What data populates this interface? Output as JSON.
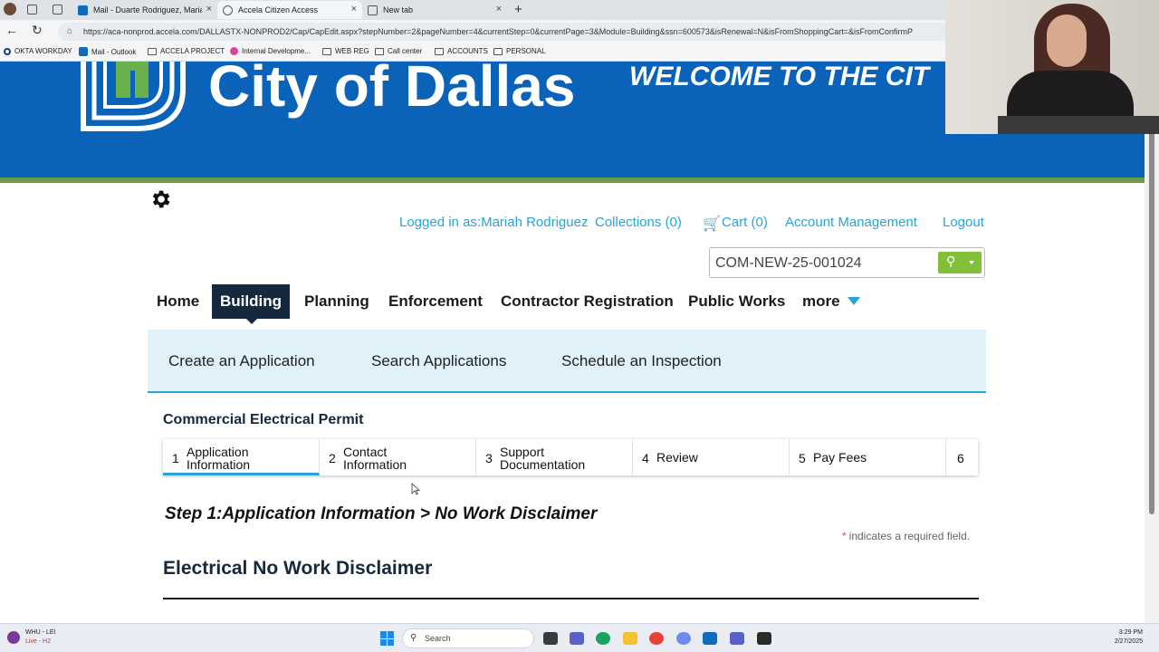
{
  "browser": {
    "tabs": [
      {
        "label": "Mail - Duarte Rodriguez, Mariah",
        "close": "×"
      },
      {
        "label": "Accela Citizen Access",
        "close": "×"
      },
      {
        "label": "New tab",
        "close": "×"
      }
    ],
    "new_tab": "+",
    "url": "https://aca-nonprod.accela.com/DALLASTX-NONPROD2/Cap/CapEdit.aspx?stepNumber=2&pageNumber=4&currentStep=0&currentPage=3&Module=Building&ssn=600573&isRenewal=N&isFromShoppingCart=&isFromConfirmP",
    "bookmarks": [
      "OKTA WORKDAY",
      "Mail - Outlook",
      "ACCELA PROJECT",
      "Internal Developme...",
      "WEB REG",
      "Call center",
      "ACCOUNTS",
      "PERSONAL"
    ]
  },
  "banner": {
    "title": "City of Dallas",
    "welcome": "WELCOME TO THE CIT"
  },
  "header": {
    "logged_in": "Logged in as:Mariah Rodriguez",
    "collections": "Collections (0)",
    "cart": "Cart (0)",
    "account": "Account Management",
    "logout": "Logout",
    "search_value": "COM-NEW-25-001024"
  },
  "nav": {
    "home": "Home",
    "building": "Building",
    "planning": "Planning",
    "enforcement": "Enforcement",
    "contractor": "Contractor Registration",
    "public_works": "Public Works",
    "more": "more"
  },
  "subnav": {
    "create": "Create an Application",
    "search": "Search Applications",
    "schedule": "Schedule an Inspection"
  },
  "permit": {
    "title": "Commercial Electrical Permit",
    "steps": [
      {
        "num": "1",
        "line1": "Application",
        "line2": "Information"
      },
      {
        "num": "2",
        "line1": "Contact",
        "line2": "Information"
      },
      {
        "num": "3",
        "line1": "Support",
        "line2": "Documentation"
      },
      {
        "num": "4",
        "line1": "Review",
        "line2": ""
      },
      {
        "num": "5",
        "line1": "Pay Fees",
        "line2": ""
      },
      {
        "num": "6",
        "line1": "",
        "line2": ""
      }
    ],
    "step_heading": "Step 1:Application Information > No Work Disclaimer",
    "required_note": "indicates a required field.",
    "required_star": "*",
    "section_title": "Electrical No Work Disclaimer"
  },
  "taskbar": {
    "weather_line1": "WHU - LEI",
    "weather_line2": "Live - H2",
    "search": "Search",
    "time": "3:29 PM",
    "date": "2/27/2025"
  },
  "colors": {
    "banner": "#0a63b8",
    "accent": "#2aa3d8",
    "nav_active": "#15283d",
    "search_button": "#82c03a"
  }
}
